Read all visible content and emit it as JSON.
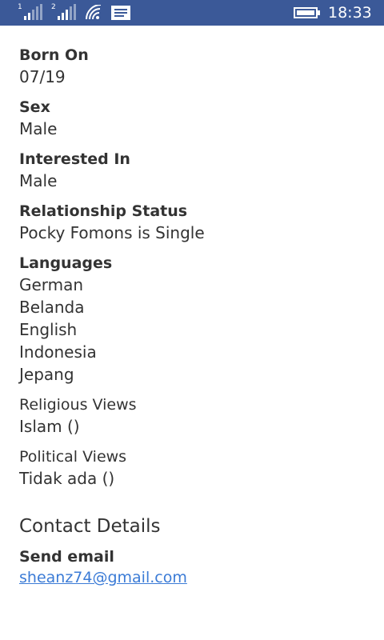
{
  "status_bar": {
    "sim1": "1",
    "sim2": "2",
    "time": "18:33",
    "background": "#3b5998"
  },
  "profile": {
    "born_on_label": "Born On",
    "born_on_value": "07/19",
    "sex_label": "Sex",
    "sex_value": "Male",
    "interested_label": "Interested In",
    "interested_value": "Male",
    "relationship_label": "Relationship Status",
    "relationship_value": "Pocky Fomons is Single",
    "languages_label": "Languages",
    "languages": [
      "German",
      "Belanda",
      "English",
      "Indonesia",
      "Jepang"
    ],
    "religious_label": "Religious Views",
    "religious_value": "Islam ()",
    "political_label": "Political Views",
    "political_value": "Tidak ada ()"
  },
  "contact": {
    "title": "Contact Details",
    "email_label": "Send email",
    "email_value": "sheanz74@gmail.com",
    "link_color": "#3b7bd6"
  }
}
